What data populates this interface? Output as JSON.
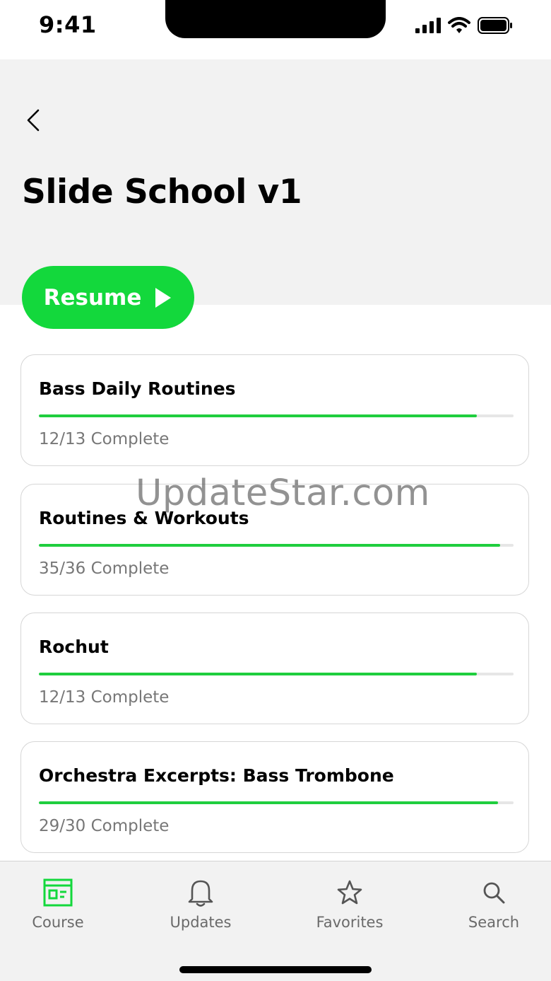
{
  "status_bar": {
    "time": "9:41"
  },
  "header": {
    "title": "Slide School v1",
    "resume_label": "Resume"
  },
  "courses": [
    {
      "title": "Bass Daily Routines",
      "status": "12/13 Complete",
      "progress": 0.923
    },
    {
      "title": "Routines & Workouts",
      "status": "35/36 Complete",
      "progress": 0.972
    },
    {
      "title": "Rochut",
      "status": "12/13 Complete",
      "progress": 0.923
    },
    {
      "title": "Orchestra Excerpts: Bass Trombone",
      "status": "29/30 Complete",
      "progress": 0.967
    }
  ],
  "watermark": "UpdateStar.com",
  "tab_bar": {
    "items": [
      {
        "label": "Course",
        "icon": "course-icon",
        "active": true
      },
      {
        "label": "Updates",
        "icon": "bell-icon",
        "active": false
      },
      {
        "label": "Favorites",
        "icon": "star-icon",
        "active": false
      },
      {
        "label": "Search",
        "icon": "search-icon",
        "active": false
      }
    ]
  },
  "colors": {
    "accent": "#13d83c",
    "progress": "#1fce3e",
    "header_bg": "#f2f2f2",
    "muted_text": "#777777"
  }
}
